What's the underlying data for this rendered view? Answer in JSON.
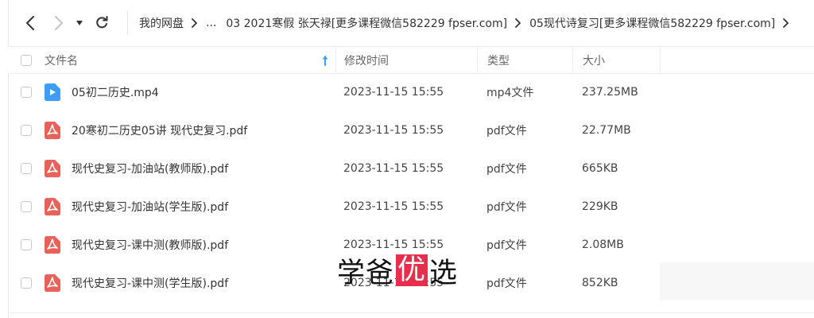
{
  "breadcrumb": {
    "items": [
      "我的网盘",
      "...",
      "03 2021寒假 张天禄[更多课程微信582229 fpser.com]",
      "05现代诗复习[更多课程微信582229 fpser.com]"
    ]
  },
  "columns": {
    "name": "文件名",
    "modified": "修改时间",
    "type": "类型",
    "size": "大小"
  },
  "files": [
    {
      "name": "05初二历史.mp4",
      "modified": "2023-11-15 15:55",
      "type": "mp4文件",
      "size": "237.25MB",
      "icon": "video-file-icon"
    },
    {
      "name": "20寒初二历史05讲 现代史复习.pdf",
      "modified": "2023-11-15 15:55",
      "type": "pdf文件",
      "size": "22.77MB",
      "icon": "pdf-file-icon"
    },
    {
      "name": "现代史复习-加油站(教师版).pdf",
      "modified": "2023-11-15 15:55",
      "type": "pdf文件",
      "size": "665KB",
      "icon": "pdf-file-icon"
    },
    {
      "name": "现代史复习-加油站(学生版).pdf",
      "modified": "2023-11-15 15:55",
      "type": "pdf文件",
      "size": "229KB",
      "icon": "pdf-file-icon"
    },
    {
      "name": "现代史复习-课中测(教师版).pdf",
      "modified": "2023-11-15 15:55",
      "type": "pdf文件",
      "size": "2.08MB",
      "icon": "pdf-file-icon"
    },
    {
      "name": "现代史复习-课中测(学生版).pdf",
      "modified": "2023-11-15 15:55",
      "type": "pdf文件",
      "size": "852KB",
      "icon": "pdf-file-icon"
    }
  ],
  "watermark": {
    "part1": "学爸",
    "accent": "优",
    "part2": "选"
  },
  "colors": {
    "video_icon": "#3d9cf5",
    "pdf_icon": "#e8615b",
    "watermark_accent": "#e62e4d"
  }
}
